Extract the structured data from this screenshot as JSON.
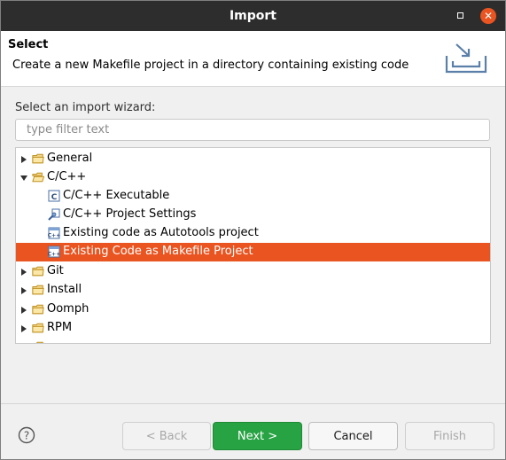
{
  "window": {
    "title": "Import"
  },
  "header": {
    "title": "Select",
    "description": "Create a new Makefile project in a directory containing existing code",
    "icon": "import-wizard-icon"
  },
  "wizard": {
    "label": "Select an import wizard:",
    "filter_placeholder": "type filter text",
    "filter_value": ""
  },
  "tree": [
    {
      "label": "General",
      "icon": "folder-icon",
      "expanded": false
    },
    {
      "label": "C/C++",
      "icon": "folder-open-icon",
      "expanded": true
    },
    {
      "label": "C/C++ Executable",
      "icon": "c-file-icon"
    },
    {
      "label": "C/C++ Project Settings",
      "icon": "project-settings-icon"
    },
    {
      "label": "Existing code as Autotools project",
      "icon": "cpp-project-icon"
    },
    {
      "label": "Existing Code as Makefile Project",
      "icon": "cpp-project-icon",
      "selected": true
    },
    {
      "label": "Git",
      "icon": "folder-icon",
      "expanded": false
    },
    {
      "label": "Install",
      "icon": "folder-icon",
      "expanded": false
    },
    {
      "label": "Oomph",
      "icon": "folder-icon",
      "expanded": false
    },
    {
      "label": "RPM",
      "icon": "folder-icon",
      "expanded": false
    }
  ],
  "buttons": {
    "back": "< Back",
    "next": "Next >",
    "cancel": "Cancel",
    "finish": "Finish"
  },
  "colors": {
    "accent": "#e95420",
    "primary_button": "#27a343",
    "titlebar": "#2d2d2d"
  }
}
